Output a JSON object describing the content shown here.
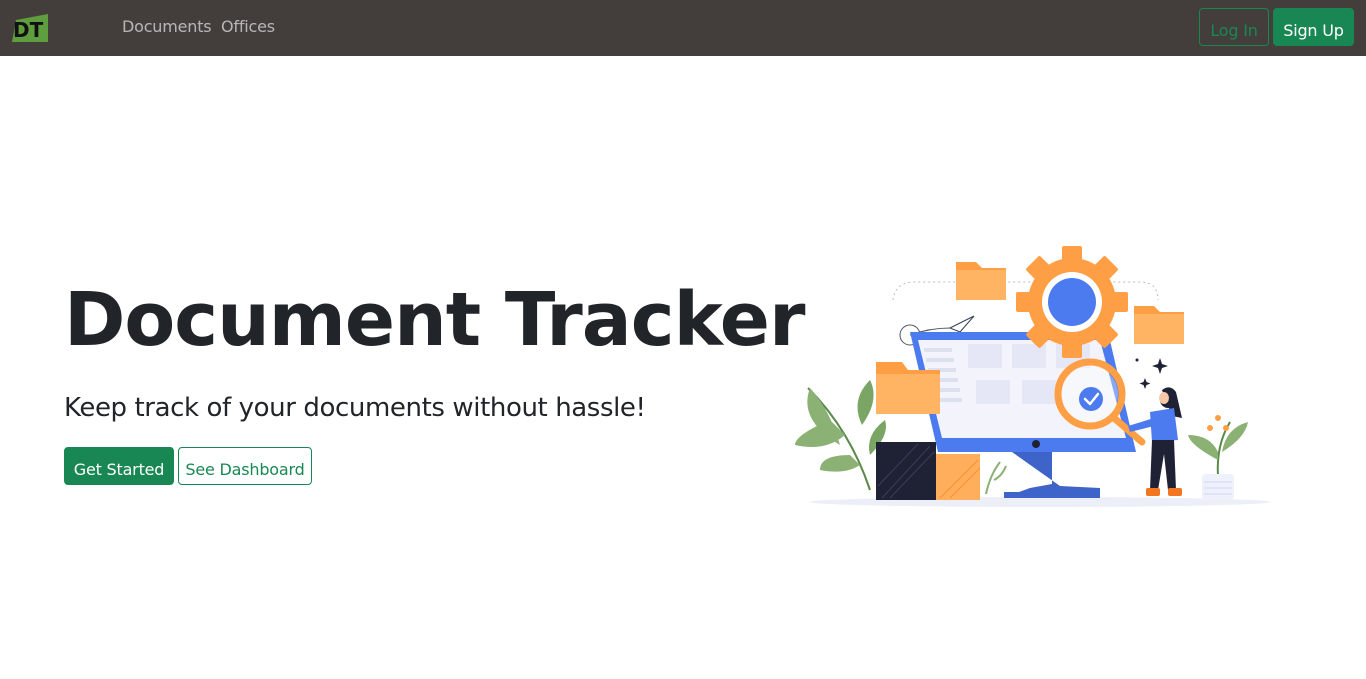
{
  "navbar": {
    "brand_logo": "DT",
    "links": [
      {
        "label": "Documents"
      },
      {
        "label": "Offices"
      }
    ],
    "login_label": "Log In",
    "signup_label": "Sign Up"
  },
  "hero": {
    "title": "Document Tracker",
    "subtitle": "Keep track of your documents without hassle!",
    "primary_button": "Get Started",
    "secondary_button": "See Dashboard"
  },
  "colors": {
    "navbar_bg": "#433e3b",
    "accent_green": "#198754",
    "illustration_blue": "#4c7bf0",
    "illustration_orange": "#ff9f45"
  },
  "icons": [
    "dt-logo-icon",
    "gear-icon",
    "folder-icon",
    "magnifier-icon",
    "check-icon",
    "paper-plane-icon",
    "sparkle-icon"
  ]
}
